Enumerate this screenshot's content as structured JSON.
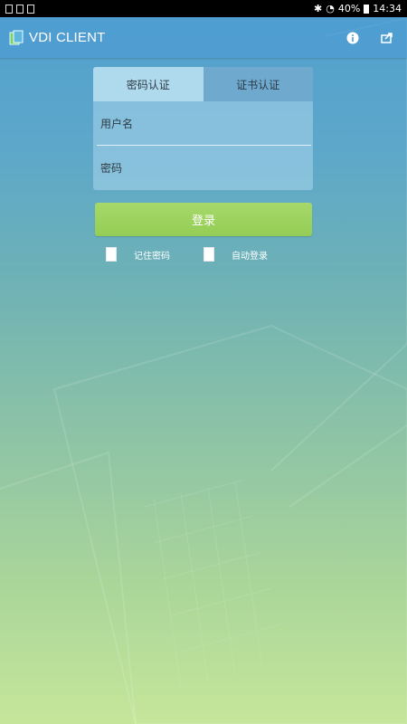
{
  "status_bar": {
    "battery": "40%",
    "time": "14:34"
  },
  "app_bar": {
    "title": "VDI CLIENT",
    "icons": [
      "info-icon",
      "share-icon"
    ]
  },
  "login_card": {
    "tabs": [
      {
        "label": "密码认证",
        "active": true
      },
      {
        "label": "证书认证",
        "active": false
      }
    ],
    "username_placeholder": "用户名",
    "password_placeholder": "密码"
  },
  "login_button": "登录",
  "options": {
    "remember_password": "记住密码",
    "auto_login": "自动登录"
  },
  "colors": {
    "accent_button": "#9bd25e",
    "app_bar": "#4f9cd2"
  }
}
